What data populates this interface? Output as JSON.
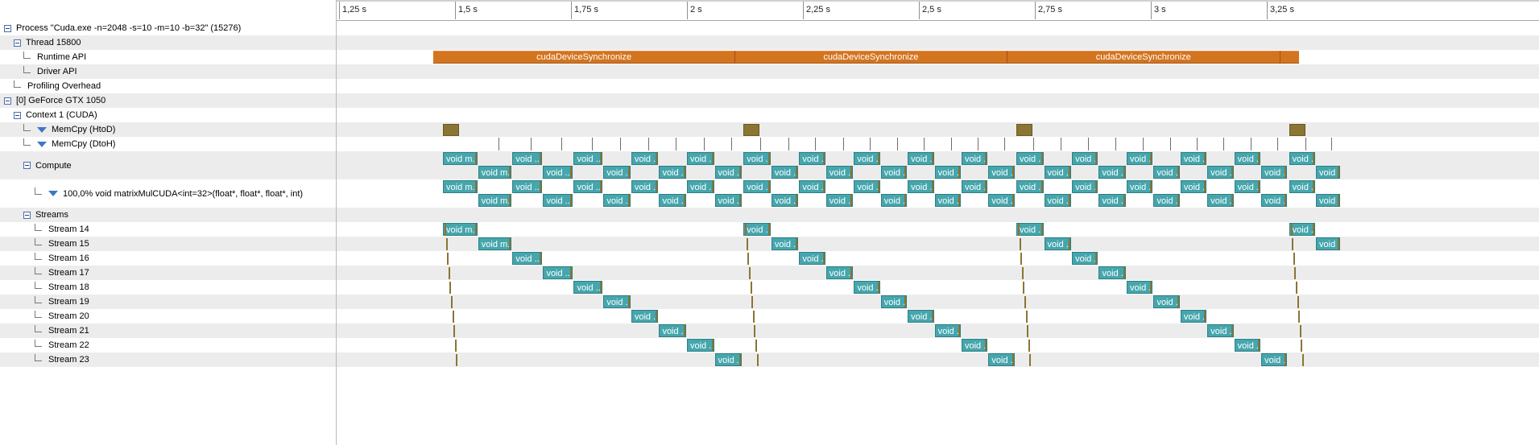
{
  "tree": {
    "rows": [
      {
        "label": "Process \"Cuda.exe -n=2048 -s=10 -m=10 -b=32\" (15276)",
        "kind": "toggle",
        "level": 0
      },
      {
        "label": "Thread 15800",
        "kind": "toggle",
        "level": 1
      },
      {
        "label": "Runtime API",
        "kind": "leaf",
        "level": 2
      },
      {
        "label": "Driver API",
        "kind": "leaf",
        "level": 2
      },
      {
        "label": "Profiling Overhead",
        "kind": "leaf",
        "level": 1
      },
      {
        "label": "[0] GeForce GTX 1050",
        "kind": "toggle",
        "level": 0
      },
      {
        "label": "Context 1 (CUDA)",
        "kind": "toggle",
        "level": 1
      },
      {
        "label": "MemCpy (HtoD)",
        "kind": "filter",
        "level": 2
      },
      {
        "label": "MemCpy (DtoH)",
        "kind": "filter",
        "level": 2
      },
      {
        "label": "Compute",
        "kind": "toggle",
        "level": 2,
        "tall": true
      },
      {
        "label": "100,0% void matrixMulCUDA<int=32>(float*, float*, float*, int)",
        "kind": "filter",
        "level": 3,
        "tall": true
      },
      {
        "label": "Streams",
        "kind": "toggle",
        "level": 2
      },
      {
        "label": "Stream 14",
        "kind": "leaf",
        "level": 3
      },
      {
        "label": "Stream 15",
        "kind": "leaf",
        "level": 3
      },
      {
        "label": "Stream 16",
        "kind": "leaf",
        "level": 3
      },
      {
        "label": "Stream 17",
        "kind": "leaf",
        "level": 3
      },
      {
        "label": "Stream 18",
        "kind": "leaf",
        "level": 3
      },
      {
        "label": "Stream 19",
        "kind": "leaf",
        "level": 3
      },
      {
        "label": "Stream 20",
        "kind": "leaf",
        "level": 3
      },
      {
        "label": "Stream 21",
        "kind": "leaf",
        "level": 3
      },
      {
        "label": "Stream 22",
        "kind": "leaf",
        "level": 3
      },
      {
        "label": "Stream 23",
        "kind": "leaf",
        "level": 3
      }
    ]
  },
  "ruler": {
    "ticks": [
      {
        "t": 1.25,
        "label": "1,25 s"
      },
      {
        "t": 1.5,
        "label": "1,5 s"
      },
      {
        "t": 1.75,
        "label": "1,75 s"
      },
      {
        "t": 2.0,
        "label": "2 s"
      },
      {
        "t": 2.25,
        "label": "2,25 s"
      },
      {
        "t": 2.5,
        "label": "2,5 s"
      },
      {
        "t": 2.75,
        "label": "2,75 s"
      },
      {
        "t": 3.0,
        "label": "3 s"
      },
      {
        "t": 3.25,
        "label": "3,25 s"
      }
    ]
  },
  "runtime_api": {
    "start": 1.453,
    "label": "cudaDeviceSynchronize",
    "segments": [
      {
        "start": 1.453,
        "end": 2.103,
        "label": "cudaDeviceSynchronize"
      },
      {
        "start": 2.103,
        "end": 2.69,
        "label": "cudaDeviceSynchronize"
      },
      {
        "start": 2.69,
        "end": 3.278,
        "label": "cudaDeviceSynchronize"
      },
      {
        "start": 3.278,
        "end": 3.32,
        "label": ""
      }
    ]
  },
  "memcpy_htod": [
    1.474,
    2.122,
    2.71,
    3.298
  ],
  "memcpy_dtoh_start": 1.55,
  "kernel_labels": {
    "long": "void m...",
    "short": "void ..."
  },
  "groups": [
    {
      "start": 1.474,
      "kernels": [
        {
          "s": 1.474,
          "e": 1.55
        },
        {
          "s": 1.55,
          "e": 1.624
        },
        {
          "s": 1.624,
          "e": 1.69
        },
        {
          "s": 1.69,
          "e": 1.756
        },
        {
          "s": 1.756,
          "e": 1.82
        },
        {
          "s": 1.82,
          "e": 1.88
        },
        {
          "s": 1.88,
          "e": 1.94
        },
        {
          "s": 1.94,
          "e": 2.0
        },
        {
          "s": 2.0,
          "e": 2.06
        },
        {
          "s": 2.06,
          "e": 2.12
        }
      ]
    },
    {
      "start": 2.122,
      "kernels": [
        {
          "s": 2.122,
          "e": 2.182
        },
        {
          "s": 2.182,
          "e": 2.242
        },
        {
          "s": 2.242,
          "e": 2.3
        },
        {
          "s": 2.3,
          "e": 2.36
        },
        {
          "s": 2.36,
          "e": 2.418
        },
        {
          "s": 2.418,
          "e": 2.476
        },
        {
          "s": 2.476,
          "e": 2.534
        },
        {
          "s": 2.534,
          "e": 2.592
        },
        {
          "s": 2.592,
          "e": 2.65
        },
        {
          "s": 2.65,
          "e": 2.708
        }
      ]
    },
    {
      "start": 2.71,
      "kernels": [
        {
          "s": 2.71,
          "e": 2.77
        },
        {
          "s": 2.77,
          "e": 2.83
        },
        {
          "s": 2.83,
          "e": 2.888
        },
        {
          "s": 2.888,
          "e": 2.948
        },
        {
          "s": 2.948,
          "e": 3.006
        },
        {
          "s": 3.006,
          "e": 3.064
        },
        {
          "s": 3.064,
          "e": 3.122
        },
        {
          "s": 3.122,
          "e": 3.18
        },
        {
          "s": 3.18,
          "e": 3.238
        },
        {
          "s": 3.238,
          "e": 3.296
        }
      ]
    },
    {
      "start": 3.298,
      "kernels": [
        {
          "s": 3.298,
          "e": 3.356
        },
        {
          "s": 3.356,
          "e": 3.41
        }
      ]
    }
  ]
}
